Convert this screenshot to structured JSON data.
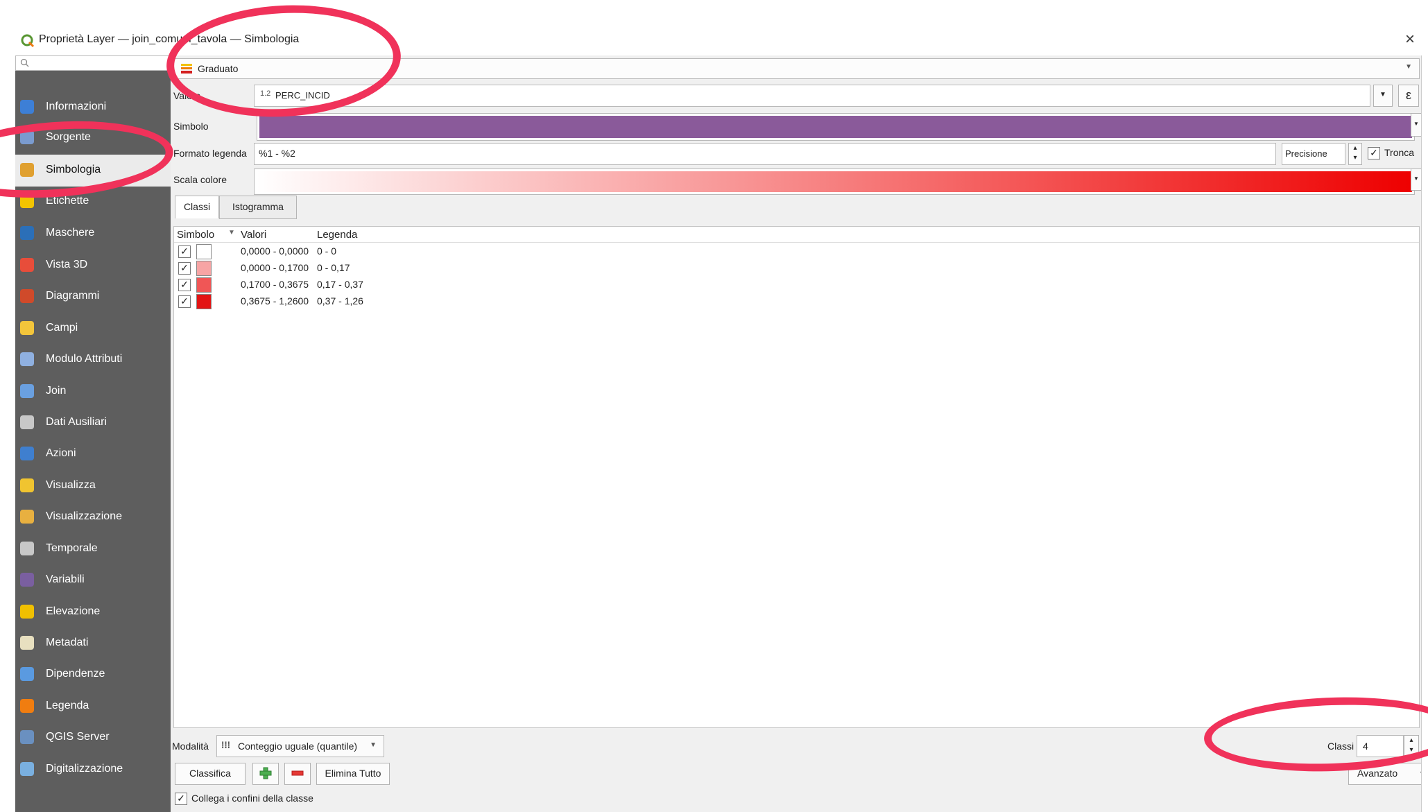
{
  "window": {
    "title": "Proprietà Layer — join_comuni_tavola — Simbologia",
    "close_glyph": "×"
  },
  "sidebar": {
    "search_placeholder": "",
    "items": [
      {
        "label": "Informazioni",
        "icon": "info-icon"
      },
      {
        "label": "Sorgente",
        "icon": "source-icon"
      },
      {
        "label": "Simbologia",
        "icon": "symbology-brush-icon",
        "active": true
      },
      {
        "label": "Etichette",
        "icon": "labels-icon"
      },
      {
        "label": "Maschere",
        "icon": "masks-icon"
      },
      {
        "label": "Vista 3D",
        "icon": "3d-view-icon"
      },
      {
        "label": "Diagrammi",
        "icon": "diagrams-icon"
      },
      {
        "label": "Campi",
        "icon": "fields-icon"
      },
      {
        "label": "Modulo Attributi",
        "icon": "attributes-form-icon"
      },
      {
        "label": "Join",
        "icon": "join-icon"
      },
      {
        "label": "Dati Ausiliari",
        "icon": "auxiliary-data-icon"
      },
      {
        "label": "Azioni",
        "icon": "actions-icon"
      },
      {
        "label": "Visualizza",
        "icon": "display-icon"
      },
      {
        "label": "Visualizzazione",
        "icon": "rendering-icon"
      },
      {
        "label": "Temporale",
        "icon": "temporal-icon"
      },
      {
        "label": "Variabili",
        "icon": "variables-icon"
      },
      {
        "label": "Elevazione",
        "icon": "elevation-icon"
      },
      {
        "label": "Metadati",
        "icon": "metadata-icon"
      },
      {
        "label": "Dipendenze",
        "icon": "dependencies-icon"
      },
      {
        "label": "Legenda",
        "icon": "legend-icon"
      },
      {
        "label": "QGIS Server",
        "icon": "qgis-server-icon"
      },
      {
        "label": "Digitalizzazione",
        "icon": "digitizing-icon"
      }
    ]
  },
  "renderer": {
    "type": "Graduato",
    "value_label": "Valore",
    "value_field": "PERC_INCID",
    "value_field_type": "1.2",
    "symbol_label": "Simbolo",
    "symbol_color": "#8a5a9a",
    "legend_format_label": "Formato legenda",
    "legend_format": "%1 - %2",
    "precision_label": "Precisione",
    "truncate_label": "Tronca",
    "color_ramp_label": "Scala colore",
    "ramp_start": "#ffffff",
    "ramp_end": "#ee0000"
  },
  "tabs": [
    {
      "label": "Classi",
      "active": true
    },
    {
      "label": "Istogramma",
      "active": false
    }
  ],
  "table": {
    "columns": [
      "Simbolo",
      "Valori",
      "Legenda"
    ],
    "rows": [
      {
        "checked": true,
        "color": "#ffffff",
        "values": "0,0000 - 0,0000",
        "legend": "0 - 0"
      },
      {
        "checked": true,
        "color": "#f7a4a4",
        "values": "0,0000 - 0,1700",
        "legend": "0 - 0,17"
      },
      {
        "checked": true,
        "color": "#f05656",
        "values": "0,1700 - 0,3675",
        "legend": "0,17 - 0,37"
      },
      {
        "checked": true,
        "color": "#e31414",
        "values": "0,3675 - 1,2600",
        "legend": "0,37 - 1,26"
      }
    ]
  },
  "bottom": {
    "mode_label": "Modalità",
    "mode_value": "Conteggio uguale (quantile)",
    "classes_label": "Classi",
    "classes_value": "4",
    "classify_label": "Classifica",
    "delete_all_label": "Elimina Tutto",
    "advanced_label": "Avanzato",
    "link_boundaries_label": "Collega i confini della classe"
  },
  "annotation_color": "#f0325a"
}
